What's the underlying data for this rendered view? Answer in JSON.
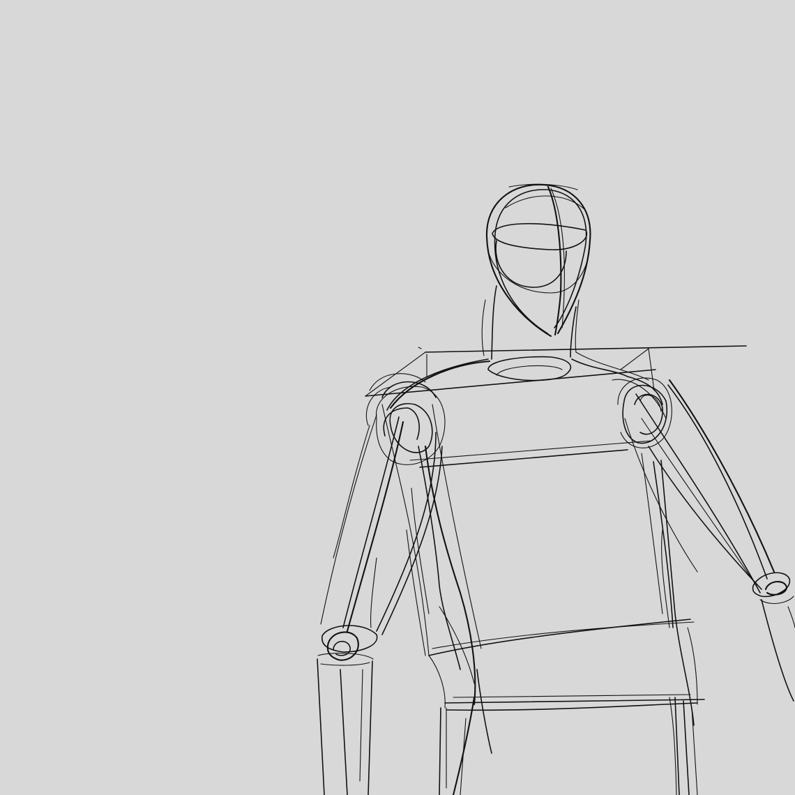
{
  "scene": {
    "subject": "pencil-construction-sketch-figure",
    "background_color": "#d8d8d8",
    "stroke_color": "#111111"
  }
}
